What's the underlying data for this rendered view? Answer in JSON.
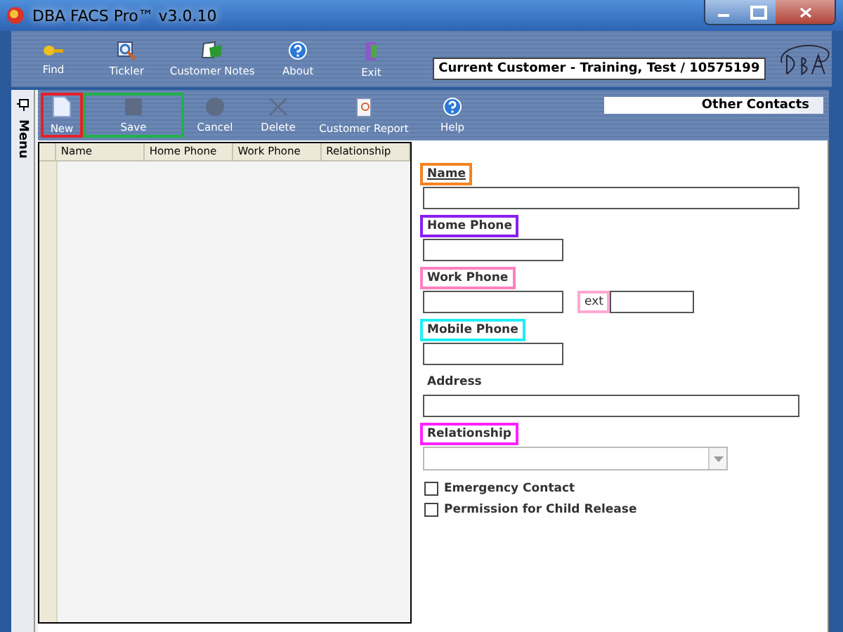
{
  "window": {
    "title": "DBA FACS Pro™ v3.0.10"
  },
  "main_toolbar": [
    {
      "label": "Find"
    },
    {
      "label": "Tickler"
    },
    {
      "label": "Customer Notes"
    },
    {
      "label": "About"
    },
    {
      "label": "Exit"
    }
  ],
  "current_customer": "Current Customer - Training, Test / 10575199",
  "side_tab": "Menu",
  "toolbar": [
    {
      "label": "New",
      "disabled": false,
      "color": "#e8202a"
    },
    {
      "label": "Save",
      "disabled": true,
      "color": "#22b04a"
    },
    {
      "label": "Cancel",
      "disabled": true
    },
    {
      "label": "Delete",
      "disabled": true
    },
    {
      "label": "Customer Report",
      "disabled": false
    },
    {
      "label": "Help",
      "disabled": false
    }
  ],
  "section_title": "Other Contacts",
  "grid": {
    "columns": [
      "Name",
      "Home Phone",
      "Work Phone",
      "Relationship"
    ]
  },
  "form": {
    "fields": [
      {
        "label": "Name",
        "kind": "long",
        "required": true,
        "color": "#f58220"
      },
      {
        "label": "Home Phone",
        "kind": "short",
        "required": false,
        "color": "#8a1ff0"
      },
      {
        "label": "Work Phone",
        "kind": "phone_ext",
        "required": false,
        "color": "#ff80c0",
        "ext": {
          "label": "ext",
          "color": "#ffa8d0"
        }
      },
      {
        "label": "Mobile Phone",
        "kind": "short",
        "required": false,
        "color": "#20eef5"
      },
      {
        "label": "Address",
        "kind": "long",
        "required": false
      },
      {
        "label": "Relationship",
        "kind": "dropdown",
        "required": false,
        "color": "#ff22ff"
      }
    ],
    "checkboxes": [
      {
        "label": "Emergency Contact",
        "checked": false
      },
      {
        "label": "Permission for Child Release",
        "checked": false
      }
    ]
  }
}
